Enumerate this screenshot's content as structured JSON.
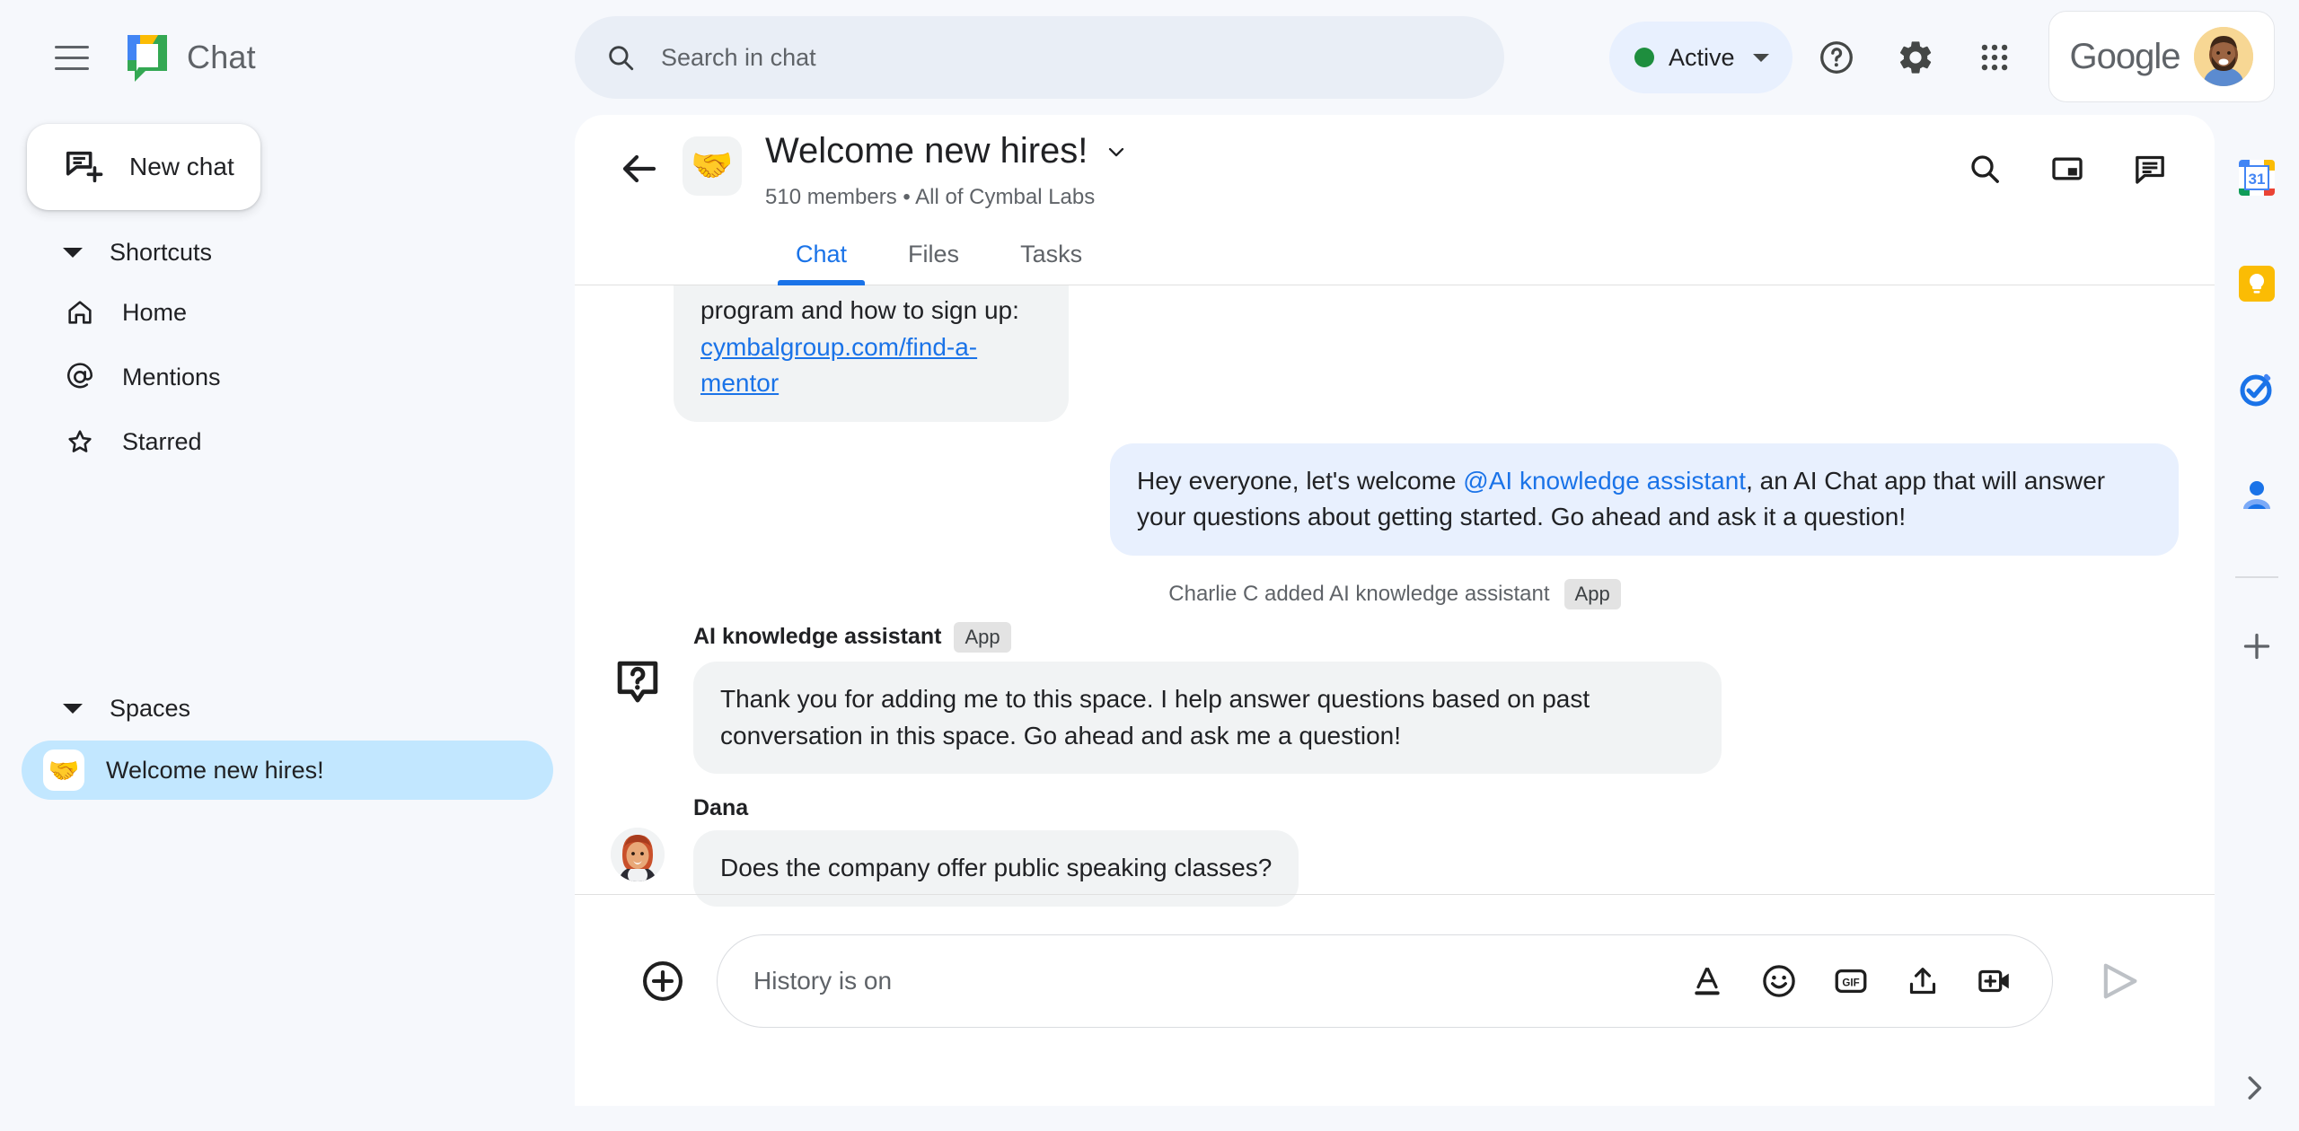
{
  "app": {
    "brand_name": "Chat",
    "brand_logo_icon": "google-chat-logo"
  },
  "topbar": {
    "menu_icon": "hamburger-menu-icon",
    "search": {
      "placeholder": "Search in chat",
      "icon": "search-icon"
    },
    "status": {
      "label": "Active",
      "dot_color": "#1e8e3e",
      "chevron_icon": "chevron-down-icon"
    },
    "help_icon": "help-circle-icon",
    "settings_icon": "gear-icon",
    "apps_icon": "apps-grid-icon",
    "account": {
      "brand_word": "Google",
      "avatar_icon": "user-avatar"
    }
  },
  "sidebar": {
    "new_chat": {
      "label": "New chat",
      "icon": "new-chat-icon"
    },
    "shortcuts": {
      "title": "Shortcuts",
      "items": [
        {
          "label": "Home",
          "icon": "home-icon"
        },
        {
          "label": "Mentions",
          "icon": "at-sign-icon"
        },
        {
          "label": "Starred",
          "icon": "star-icon"
        }
      ]
    },
    "spaces": {
      "title": "Spaces",
      "items": [
        {
          "label": "Welcome new hires!",
          "emoji": "🤝",
          "active": true
        }
      ]
    }
  },
  "chat_header": {
    "back_icon": "back-arrow-icon",
    "emoji": "🤝",
    "title": "Welcome new hires!",
    "title_chevron_icon": "chevron-down-icon",
    "members": "510 members",
    "separator": "•",
    "org": "All of Cymbal Labs",
    "subtitle": "510 members  •  All of Cymbal Labs",
    "icons": {
      "search": "search-icon",
      "pip": "picture-in-picture-icon",
      "threads": "chat-bubble-icon"
    },
    "tabs": [
      {
        "label": "Chat",
        "active": true
      },
      {
        "label": "Files",
        "active": false
      },
      {
        "label": "Tasks",
        "active": false
      }
    ]
  },
  "messages": [
    {
      "type": "clipped-incoming",
      "text_line1": "program and how to sign up:",
      "link_text": "cymbalgroup.com/find-a-mentor"
    },
    {
      "type": "outgoing",
      "text_before": "Hey everyone, let's welcome ",
      "mention": "@AI knowledge assistant",
      "text_after": ", an AI Chat app that will answer your questions about getting started.  Go ahead and ask it a question!"
    },
    {
      "type": "system",
      "text": "Charlie C added AI knowledge assistant",
      "badge": "App"
    },
    {
      "type": "incoming",
      "sender": "AI knowledge assistant",
      "badge": "App",
      "avatar_icon": "question-bubble-icon",
      "text": "Thank you for adding me to this space. I help answer questions based on past conversation in this space. Go ahead and ask me a question!"
    },
    {
      "type": "incoming",
      "sender": "Dana",
      "badge": "",
      "avatar_icon": "dana-avatar",
      "text": "Does the company offer public speaking classes?"
    }
  ],
  "composer": {
    "add_icon": "plus-circle-icon",
    "placeholder": "History is on",
    "tools": [
      {
        "icon": "format-text-icon",
        "name": "format"
      },
      {
        "icon": "emoji-icon",
        "name": "emoji"
      },
      {
        "icon": "gif-icon",
        "name": "gif",
        "label": "GIF"
      },
      {
        "icon": "upload-icon",
        "name": "upload"
      },
      {
        "icon": "add-video-icon",
        "name": "video"
      }
    ],
    "send_icon": "send-icon"
  },
  "right_rail": {
    "items": [
      {
        "icon": "google-calendar-icon",
        "name": "calendar",
        "badge": "31"
      },
      {
        "icon": "google-keep-icon",
        "name": "keep"
      },
      {
        "icon": "google-tasks-icon",
        "name": "tasks"
      },
      {
        "icon": "google-contacts-icon",
        "name": "contacts"
      }
    ],
    "add_icon": "plus-icon",
    "expand_icon": "chevron-right-icon"
  },
  "colors": {
    "page_bg": "#f6f8fc",
    "panel_bg": "#ffffff",
    "accent_blue": "#1a73e8",
    "bubble_incoming": "#f1f3f4",
    "bubble_outgoing": "#e8f0fe",
    "space_active": "#c2e7ff",
    "status_green": "#1e8e3e"
  }
}
